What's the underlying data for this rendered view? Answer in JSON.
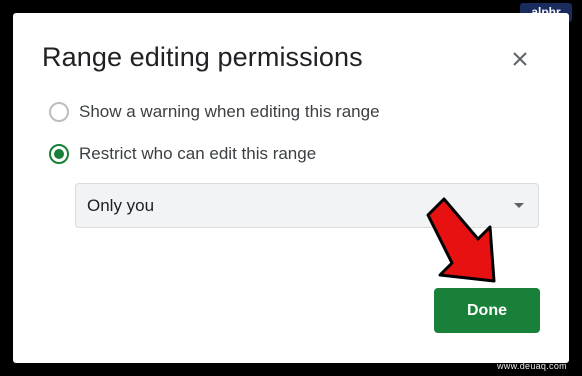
{
  "brand_badge": "alphr",
  "dialog": {
    "title": "Range editing permissions",
    "options": [
      {
        "label": "Show a warning when editing this range",
        "checked": false
      },
      {
        "label": "Restrict who can edit this range",
        "checked": true
      }
    ],
    "select": {
      "value": "Only you"
    },
    "done_label": "Done"
  },
  "watermark": "www.deuaq.com",
  "colors": {
    "accent_green": "#188038",
    "arrow_red": "#e81111",
    "badge_navy": "#1a2b5e"
  },
  "icons": {
    "close": "close-icon",
    "caret": "chevron-down-icon",
    "annotation": "arrow-annotation-icon"
  }
}
